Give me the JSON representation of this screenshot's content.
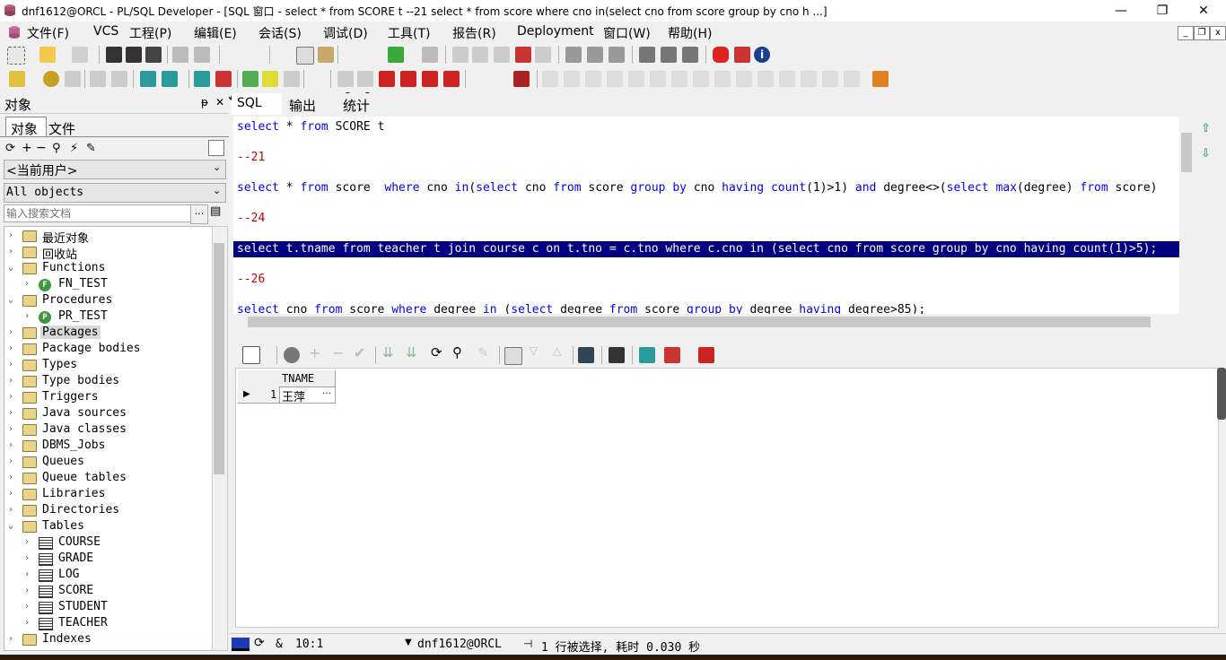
{
  "window": {
    "title": "dnf1612@ORCL - PL/SQL Developer - [SQL 窗口 - select * from SCORE t --21 select * from score where cno in(select cno from score group by cno h ...]",
    "minimize": "—",
    "restore": "❐",
    "close": "✕"
  },
  "menu": [
    {
      "label": "文件(F)"
    },
    {
      "label": "VCS"
    },
    {
      "label": "工程(P)"
    },
    {
      "label": "编辑(E)"
    },
    {
      "label": "会话(S)"
    },
    {
      "label": "调试(D)"
    },
    {
      "label": "工具(T)"
    },
    {
      "label": "报告(R)"
    },
    {
      "label": "Deployment"
    },
    {
      "label": "窗口(W)"
    },
    {
      "label": "帮助(H)"
    }
  ],
  "mdi": {
    "minimize": "_",
    "restore": "❐",
    "close": "x"
  },
  "left_panel": {
    "title": "对象",
    "pin": "ᵽ",
    "close": "✕",
    "tabs": [
      "对象",
      "文件"
    ],
    "user_select": "<当前用户>",
    "filter_select": "All objects",
    "search_placeholder": "输入搜索文档",
    "search_more": "...",
    "tree": [
      {
        "label": "最近对象",
        "type": "folder",
        "level": 0,
        "expander": "›"
      },
      {
        "label": "回收站",
        "type": "folder",
        "level": 0,
        "expander": "›"
      },
      {
        "label": "Functions",
        "type": "folder",
        "level": 0,
        "expander": "⌄"
      },
      {
        "label": "FN_TEST",
        "type": "function",
        "level": 1,
        "expander": "›"
      },
      {
        "label": "Procedures",
        "type": "folder",
        "level": 0,
        "expander": "⌄"
      },
      {
        "label": "PR_TEST",
        "type": "procedure",
        "level": 1,
        "expander": "›"
      },
      {
        "label": "Packages",
        "type": "folder",
        "level": 0,
        "expander": "›",
        "selected": true
      },
      {
        "label": "Package bodies",
        "type": "folder",
        "level": 0,
        "expander": "›"
      },
      {
        "label": "Types",
        "type": "folder",
        "level": 0,
        "expander": "›"
      },
      {
        "label": "Type bodies",
        "type": "folder",
        "level": 0,
        "expander": "›"
      },
      {
        "label": "Triggers",
        "type": "folder",
        "level": 0,
        "expander": "›"
      },
      {
        "label": "Java sources",
        "type": "folder",
        "level": 0,
        "expander": "›"
      },
      {
        "label": "Java classes",
        "type": "folder",
        "level": 0,
        "expander": "›"
      },
      {
        "label": "DBMS_Jobs",
        "type": "folder",
        "level": 0,
        "expander": "›"
      },
      {
        "label": "Queues",
        "type": "folder",
        "level": 0,
        "expander": "›"
      },
      {
        "label": "Queue tables",
        "type": "folder",
        "level": 0,
        "expander": "›"
      },
      {
        "label": "Libraries",
        "type": "folder",
        "level": 0,
        "expander": "›"
      },
      {
        "label": "Directories",
        "type": "folder",
        "level": 0,
        "expander": "›"
      },
      {
        "label": "Tables",
        "type": "folder",
        "level": 0,
        "expander": "⌄"
      },
      {
        "label": "COURSE",
        "type": "table",
        "level": 1,
        "expander": "›"
      },
      {
        "label": "GRADE",
        "type": "table",
        "level": 1,
        "expander": "›"
      },
      {
        "label": "LOG",
        "type": "table",
        "level": 1,
        "expander": "›"
      },
      {
        "label": "SCORE",
        "type": "table",
        "level": 1,
        "expander": "›"
      },
      {
        "label": "STUDENT",
        "type": "table",
        "level": 1,
        "expander": "›"
      },
      {
        "label": "TEACHER",
        "type": "table",
        "level": 1,
        "expander": "›"
      },
      {
        "label": "Indexes",
        "type": "folder",
        "level": 0,
        "expander": "›"
      }
    ]
  },
  "editor": {
    "tabs": [
      "SQL",
      "输出",
      "统计"
    ],
    "active_tab": "SQL",
    "lines": [
      {
        "kind": "code",
        "text": "select * from SCORE t"
      },
      {
        "kind": "comment",
        "text": "--21"
      },
      {
        "kind": "code",
        "text": "select * from score  where cno in(select cno from score group by cno having count(1)>1) and degree<>(select max(degree) from score)"
      },
      {
        "kind": "comment",
        "text": "--24"
      },
      {
        "kind": "selected",
        "text": "select t.tname from teacher t join course c on t.tno = c.tno where c.cno in (select cno from score group by cno having count(1)>5);"
      },
      {
        "kind": "comment",
        "text": "--26"
      },
      {
        "kind": "code",
        "text": "select cno from score where degree in (select degree from score group by degree having degree>85);"
      }
    ]
  },
  "results": {
    "columns": [
      "TNAME"
    ],
    "rows": [
      {
        "num": "1",
        "values": [
          "王萍"
        ],
        "more": "…"
      }
    ]
  },
  "status": {
    "position": "10:1",
    "connection": "dnf1612@ORCL",
    "message": "1 行被选择, 耗时 0.030 秒",
    "amp": "&"
  },
  "colors": {
    "selection": "#000080",
    "keyword": "#0000ff",
    "comment": "#cc0000"
  }
}
